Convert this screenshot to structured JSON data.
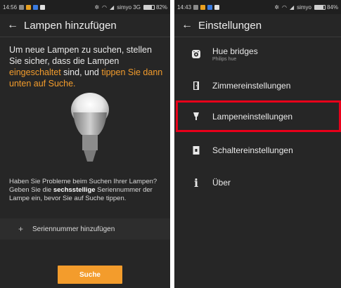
{
  "left": {
    "status": {
      "time": "14:56",
      "carrier": "simyo 3G",
      "battery": "82%",
      "battery_level": 0.82
    },
    "title": "Lampen hinzufügen",
    "instruction": {
      "part1": "Um neue Lampen zu suchen, stellen Sie sicher, dass die Lampen ",
      "highlight1": "eingeschaltet",
      "part2": " sind, und ",
      "highlight2": "tippen Sie dann unten auf Suche",
      "part3": "."
    },
    "help": {
      "part1": "Haben Sie Probleme beim Suchen Ihrer Lampen? Geben Sie die ",
      "bold": "sechsstellige",
      "part2": " Seriennummer der Lampe ein, bevor Sie auf Suche tippen."
    },
    "serial_label": "Seriennummer hinzufügen",
    "search_label": "Suche",
    "accent_color": "#f39c2c"
  },
  "right": {
    "status": {
      "time": "14:43",
      "carrier": "simyo",
      "battery": "84%",
      "battery_level": 0.84
    },
    "title": "Einstellungen",
    "menu": [
      {
        "label": "Hue bridges",
        "sub": "Philips hue",
        "icon": "bridge-icon"
      },
      {
        "label": "Zimmereinstellungen",
        "icon": "door-icon"
      },
      {
        "label": "Lampeneinstellungen",
        "icon": "lamp-icon"
      },
      {
        "label": "Schaltereinstellungen",
        "icon": "switch-icon"
      },
      {
        "label": "Über",
        "icon": "info-icon"
      }
    ],
    "highlight_color": "#e8001a"
  }
}
